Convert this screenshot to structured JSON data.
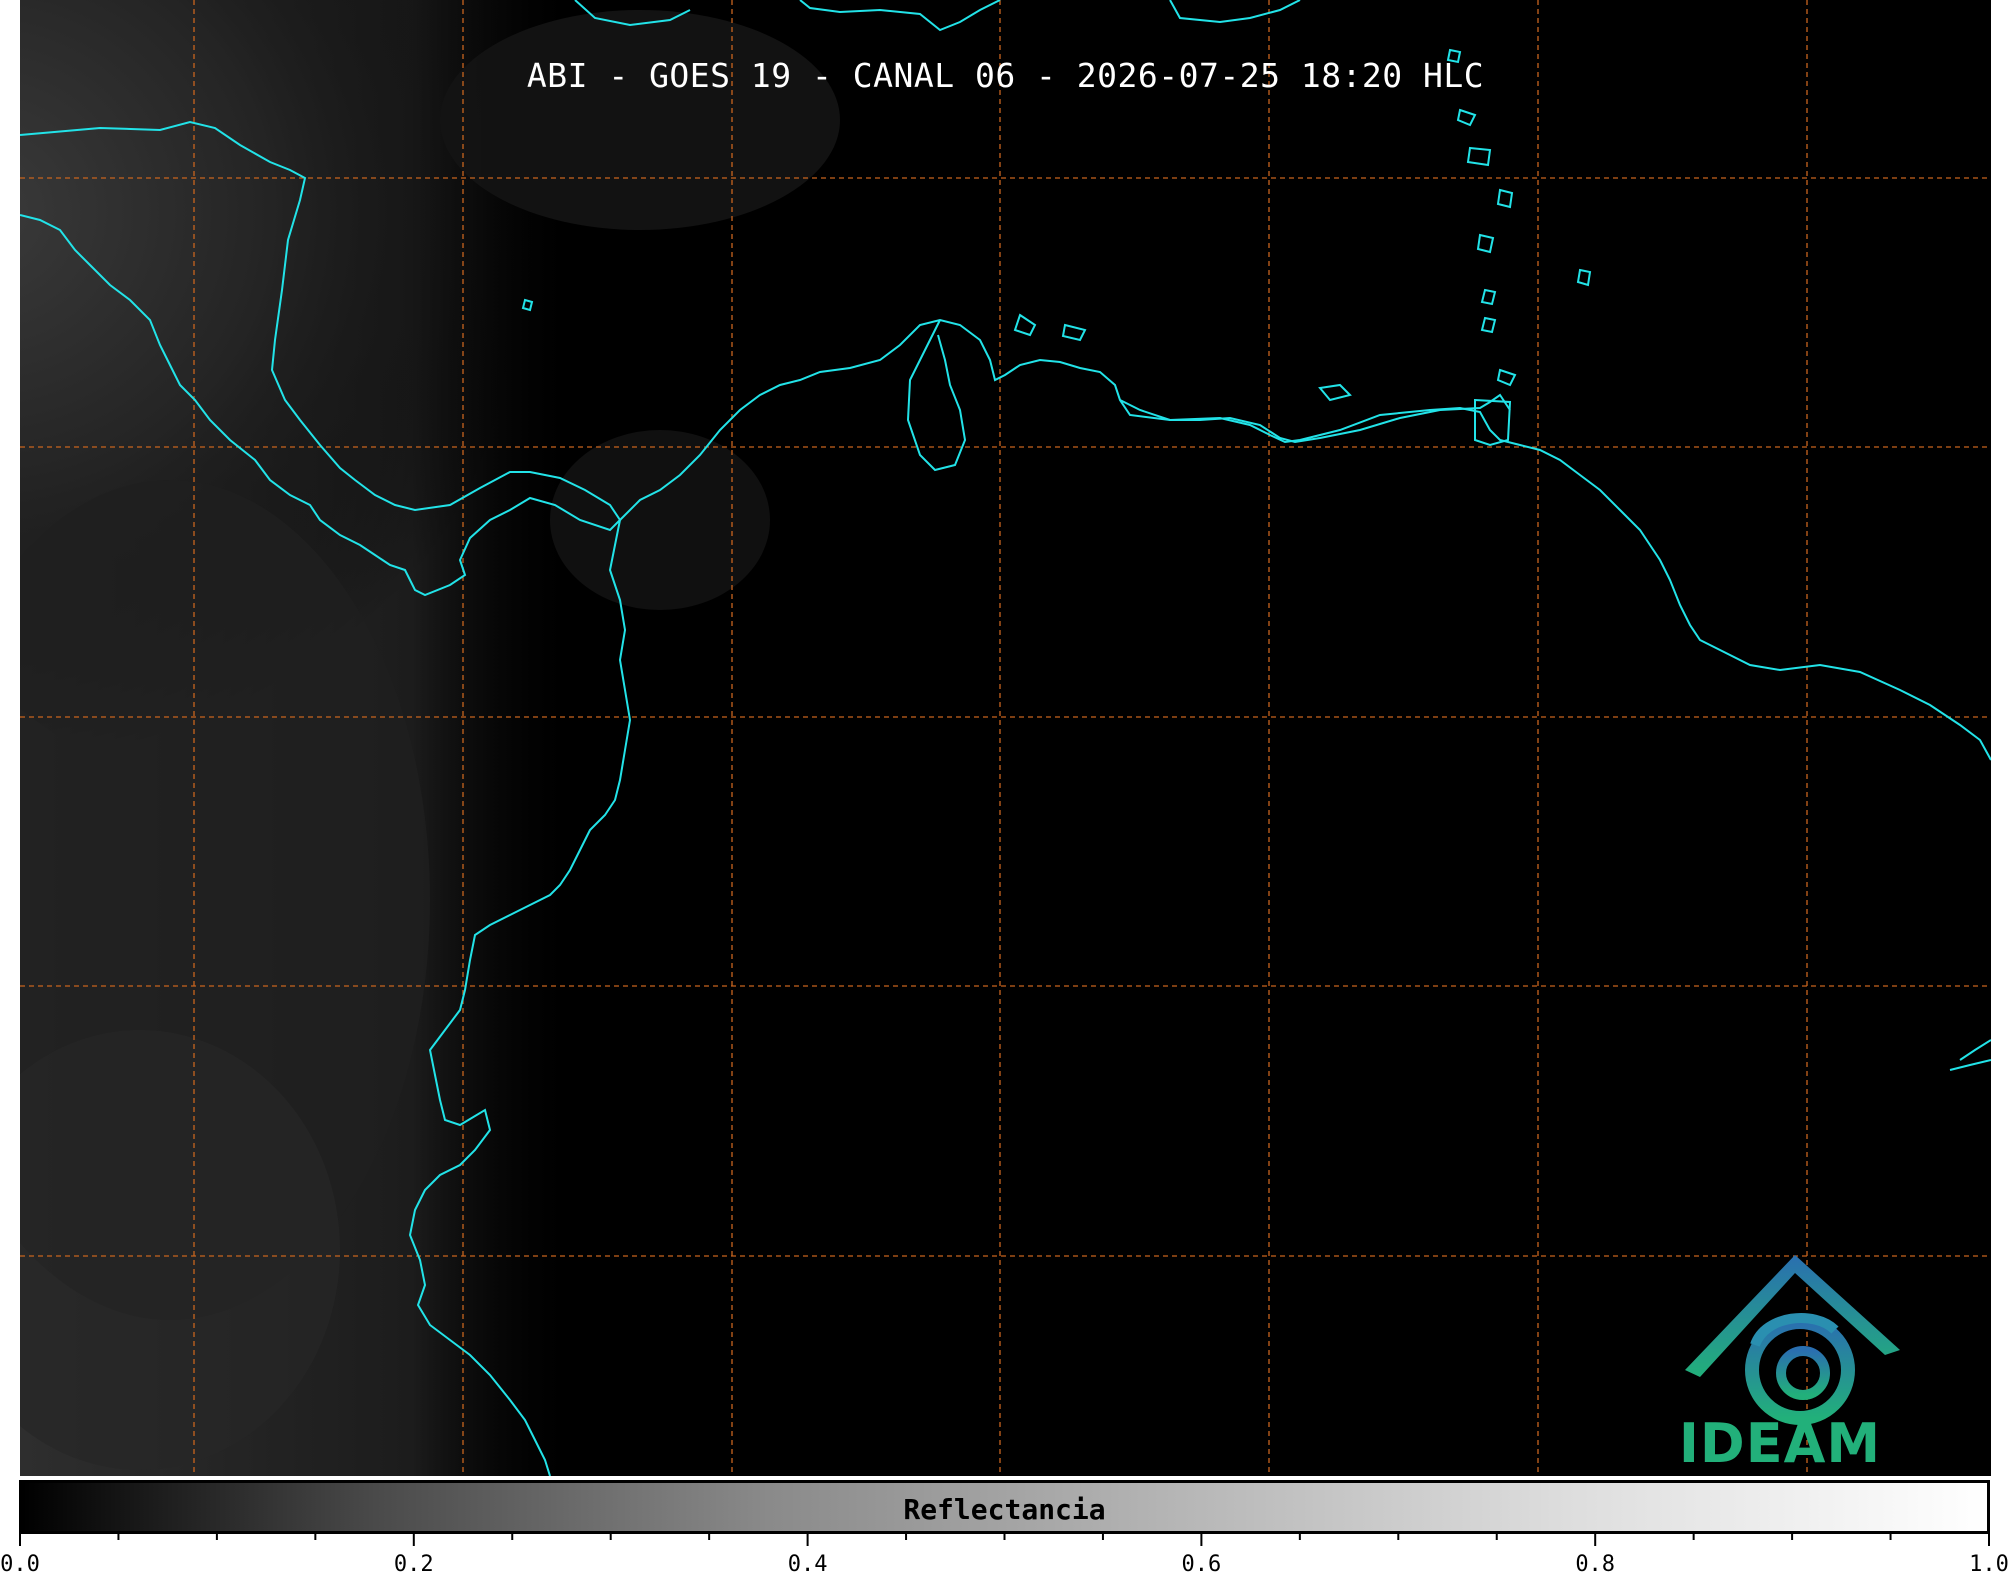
{
  "title": "ABI - GOES 19 - CANAL 06 - 2026-07-25 18:20 HLC",
  "colors": {
    "background": "#000000",
    "coastline": "#22e3e8",
    "grid": "#c8641e",
    "logo_green": "#22b07a",
    "logo_blue": "#2a6fb0"
  },
  "colorbar": {
    "label": "Reflectancia",
    "range": [
      0.0,
      1.0
    ],
    "ticks": [
      "0.0",
      "0.2",
      "0.4",
      "0.6",
      "0.8",
      "1.0"
    ],
    "minor_ticks_per_interval": 4,
    "colormap": "grayscale"
  },
  "logo": {
    "text": "IDEAM"
  }
}
